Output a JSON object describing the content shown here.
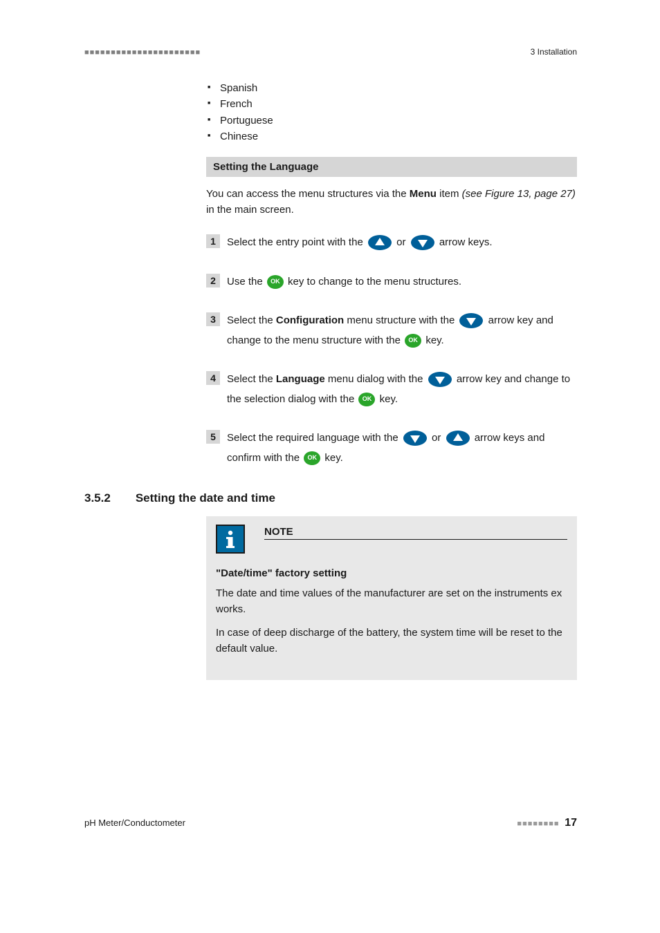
{
  "header": {
    "dashes": "■■■■■■■■■■■■■■■■■■■■■■",
    "chapter": "3 Installation"
  },
  "languages": [
    "Spanish",
    "French",
    "Portuguese",
    "Chinese"
  ],
  "section_bar": "Setting the Language",
  "intro": {
    "t1": "You can access the menu structures via the ",
    "menu": "Menu",
    "t2": " item ",
    "ref": "(see Figure 13, page 27)",
    "t3": " in the main screen."
  },
  "ok_label": "OK",
  "steps": {
    "s1": {
      "num": "1",
      "a": "Select the entry point with the ",
      "b": " or ",
      "c": " arrow keys."
    },
    "s2": {
      "num": "2",
      "a": "Use the ",
      "b": " key to change to the menu structures."
    },
    "s3": {
      "num": "3",
      "a": "Select the ",
      "bold": "Configuration",
      "b": " menu structure with the ",
      "c": " arrow key and change to the menu structure with the ",
      "d": " key."
    },
    "s4": {
      "num": "4",
      "a": "Select the ",
      "bold": "Language",
      "b": " menu dialog with the ",
      "c": " arrow key and change to the selection dialog with the ",
      "d": " key."
    },
    "s5": {
      "num": "5",
      "a": "Select the required language with the ",
      "b": " or ",
      "c": " arrow keys and confirm with the ",
      "d": " key."
    }
  },
  "subsection": {
    "num": "3.5.2",
    "title": "Setting the date and time"
  },
  "note": {
    "title": "NOTE",
    "sub": "\"Date/time\" factory setting",
    "p1": "The date and time values of the manufacturer are set on the instruments ex works.",
    "p2": "In case of deep discharge of the battery, the system time will be reset to the default value."
  },
  "footer": {
    "left": "pH Meter/Conductometer",
    "dashes": "■■■■■■■■",
    "page": "17"
  }
}
